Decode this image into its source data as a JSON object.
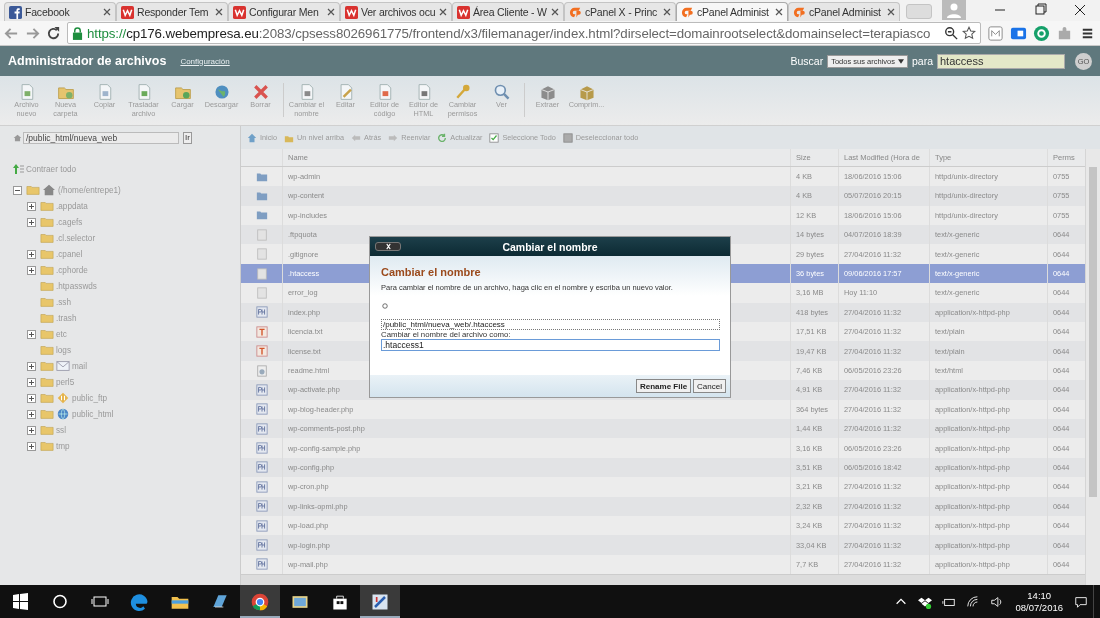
{
  "browser": {
    "tabs": [
      {
        "title": "Facebook",
        "kind": "facebook",
        "selected": false
      },
      {
        "title": "Responder Tem",
        "kind": "w",
        "selected": false
      },
      {
        "title": "Configurar Men",
        "kind": "w",
        "selected": false
      },
      {
        "title": "Ver archivos ocu",
        "kind": "w",
        "selected": false
      },
      {
        "title": "Área Cliente - W",
        "kind": "w",
        "selected": false
      },
      {
        "title": "cPanel X - Princ",
        "kind": "cpanel",
        "selected": false
      },
      {
        "title": "cPanel Administ",
        "kind": "cpanel",
        "selected": true
      },
      {
        "title": "cPanel Administ",
        "kind": "cpanel",
        "selected": false
      }
    ],
    "url": {
      "scheme": "https://",
      "host": "cp176.webempresa.eu",
      "rest": ":2083/cpsess8026961775/frontend/x3/filemanager/index.html?dirselect=domainrootselect&domainselect=terapiasco"
    }
  },
  "header": {
    "title": "Administrador de archivos",
    "settings_link": "Configuración",
    "search_label": "Buscar",
    "scope": "Todos sus archivos",
    "for_label": "para",
    "query": "htaccess",
    "go": "GO"
  },
  "toolbar": {
    "groups": [
      {
        "items": [
          {
            "label": "Archivo nuevo",
            "kind": "new-file"
          },
          {
            "label": "Nueva carpeta",
            "kind": "new-folder"
          },
          {
            "label": "Copiar",
            "kind": "copy"
          },
          {
            "label": "Trasladar archivo",
            "kind": "move"
          },
          {
            "label": "Cargar",
            "kind": "upload"
          },
          {
            "label": "Descargar",
            "kind": "download"
          },
          {
            "label": "Borrar",
            "kind": "delete"
          }
        ]
      },
      {
        "items": [
          {
            "label": "Cambiar el nombre",
            "kind": "rename"
          },
          {
            "label": "Editar",
            "kind": "edit"
          },
          {
            "label": "Editor de código",
            "kind": "code"
          },
          {
            "label": "Editor de HTML",
            "kind": "html"
          },
          {
            "label": "Cambiar permisos",
            "kind": "permissions"
          },
          {
            "label": "Ver",
            "kind": "view"
          }
        ]
      },
      {
        "items": [
          {
            "label": "Extraer",
            "kind": "extract"
          },
          {
            "label": "Comprim...",
            "kind": "compress"
          }
        ]
      }
    ]
  },
  "path": {
    "value": "/public_html/nueva_web",
    "go": "Ir"
  },
  "nav": [
    {
      "label": "Inicio",
      "kind": "home"
    },
    {
      "label": "Un nivel arriba",
      "kind": "up"
    },
    {
      "label": "Atrás",
      "kind": "back"
    },
    {
      "label": "Reenviar",
      "kind": "forward"
    },
    {
      "label": "Actualizar",
      "kind": "refresh"
    },
    {
      "label": "Seleccione Todo",
      "kind": "check"
    },
    {
      "label": "Deseleccionar todo",
      "kind": "uncheck"
    }
  ],
  "tree": {
    "collapse_all": "Contraer todo",
    "root": {
      "name": "(/home/entrepe1)",
      "expanded": true,
      "children": [
        {
          "name": ".appdata",
          "kind": "folder",
          "collapsed": true
        },
        {
          "name": ".cagefs",
          "kind": "folder",
          "collapsed": true
        },
        {
          "name": ".cl.selector",
          "kind": "folder",
          "collapsed": false
        },
        {
          "name": ".cpanel",
          "kind": "folder",
          "collapsed": true
        },
        {
          "name": ".cphorde",
          "kind": "folder",
          "collapsed": true
        },
        {
          "name": ".htpasswds",
          "kind": "folder",
          "collapsed": false
        },
        {
          "name": ".ssh",
          "kind": "folder",
          "collapsed": false
        },
        {
          "name": ".trash",
          "kind": "folder",
          "collapsed": false
        },
        {
          "name": "etc",
          "kind": "folder",
          "collapsed": true
        },
        {
          "name": "logs",
          "kind": "folder",
          "collapsed": false
        },
        {
          "name": "mail",
          "kind": "mail",
          "collapsed": true
        },
        {
          "name": "perl5",
          "kind": "folder",
          "collapsed": true
        },
        {
          "name": "public_ftp",
          "kind": "ftp",
          "collapsed": true
        },
        {
          "name": "public_html",
          "kind": "web",
          "collapsed": true
        },
        {
          "name": "ssl",
          "kind": "folder",
          "collapsed": true
        },
        {
          "name": "tmp",
          "kind": "folder",
          "collapsed": true
        }
      ]
    }
  },
  "table": {
    "columns": [
      "Name",
      "Size",
      "Last Modified (Hora de",
      "Type",
      "Perms"
    ],
    "rows": [
      {
        "kind": "folder",
        "name": "wp-admin",
        "size": "4 KB",
        "modified": "18/06/2016 15:06",
        "type": "httpd/unix-directory",
        "perms": "0755",
        "selected": false
      },
      {
        "kind": "folder",
        "name": "wp-content",
        "size": "4 KB",
        "modified": "05/07/2016 20:15",
        "type": "httpd/unix-directory",
        "perms": "0755",
        "selected": false
      },
      {
        "kind": "folder",
        "name": "wp-includes",
        "size": "12 KB",
        "modified": "18/06/2016 15:06",
        "type": "httpd/unix-directory",
        "perms": "0755",
        "selected": false
      },
      {
        "kind": "text",
        "name": ".ftpquota",
        "size": "14 bytes",
        "modified": "04/07/2016 18:39",
        "type": "text/x-generic",
        "perms": "0644",
        "selected": false
      },
      {
        "kind": "text",
        "name": ".gitignore",
        "size": "29 bytes",
        "modified": "27/04/2016 11:32",
        "type": "text/x-generic",
        "perms": "0644",
        "selected": false
      },
      {
        "kind": "text",
        "name": ".htaccess",
        "size": "36 bytes",
        "modified": "09/06/2016 17:57",
        "type": "text/x-generic",
        "perms": "0644",
        "selected": true
      },
      {
        "kind": "text",
        "name": "error_log",
        "size": "3,16 MB",
        "modified": "Hoy 11:10",
        "type": "text/x-generic",
        "perms": "0644",
        "selected": false
      },
      {
        "kind": "php",
        "name": "index.php",
        "size": "418 bytes",
        "modified": "27/04/2016 11:32",
        "type": "application/x-httpd-php",
        "perms": "0644",
        "selected": false
      },
      {
        "kind": "txt",
        "name": "licencia.txt",
        "size": "17,51 KB",
        "modified": "27/04/2016 11:32",
        "type": "text/plain",
        "perms": "0644",
        "selected": false
      },
      {
        "kind": "txt",
        "name": "license.txt",
        "size": "19,47 KB",
        "modified": "27/04/2016 11:32",
        "type": "text/plain",
        "perms": "0644",
        "selected": false
      },
      {
        "kind": "html",
        "name": "readme.html",
        "size": "7,46 KB",
        "modified": "06/05/2016 23:26",
        "type": "text/html",
        "perms": "0644",
        "selected": false
      },
      {
        "kind": "php",
        "name": "wp-activate.php",
        "size": "4,91 KB",
        "modified": "27/04/2016 11:32",
        "type": "application/x-httpd-php",
        "perms": "0644",
        "selected": false
      },
      {
        "kind": "php",
        "name": "wp-blog-header.php",
        "size": "364 bytes",
        "modified": "27/04/2016 11:32",
        "type": "application/x-httpd-php",
        "perms": "0644",
        "selected": false
      },
      {
        "kind": "php",
        "name": "wp-comments-post.php",
        "size": "1,44 KB",
        "modified": "27/04/2016 11:32",
        "type": "application/x-httpd-php",
        "perms": "0644",
        "selected": false
      },
      {
        "kind": "php",
        "name": "wp-config-sample.php",
        "size": "3,16 KB",
        "modified": "06/05/2016 23:26",
        "type": "application/x-httpd-php",
        "perms": "0644",
        "selected": false
      },
      {
        "kind": "php",
        "name": "wp-config.php",
        "size": "3,51 KB",
        "modified": "06/05/2016 18:42",
        "type": "application/x-httpd-php",
        "perms": "0644",
        "selected": false
      },
      {
        "kind": "php",
        "name": "wp-cron.php",
        "size": "3,21 KB",
        "modified": "27/04/2016 11:32",
        "type": "application/x-httpd-php",
        "perms": "0644",
        "selected": false
      },
      {
        "kind": "php",
        "name": "wp-links-opml.php",
        "size": "2,32 KB",
        "modified": "27/04/2016 11:32",
        "type": "application/x-httpd-php",
        "perms": "0644",
        "selected": false
      },
      {
        "kind": "php",
        "name": "wp-load.php",
        "size": "3,24 KB",
        "modified": "27/04/2016 11:32",
        "type": "application/x-httpd-php",
        "perms": "0644",
        "selected": false
      },
      {
        "kind": "php",
        "name": "wp-login.php",
        "size": "33,04 KB",
        "modified": "27/04/2016 11:32",
        "type": "application/x-httpd-php",
        "perms": "0644",
        "selected": false
      },
      {
        "kind": "php",
        "name": "wp-mail.php",
        "size": "7,7 KB",
        "modified": "27/04/2016 11:32",
        "type": "application/x-httpd-php",
        "perms": "0644",
        "selected": false
      }
    ]
  },
  "dialog": {
    "title": "Cambiar el nombre",
    "heading": "Cambiar el nombre",
    "text": "Para cambiar el nombre de un archivo, haga clic en el nombre y escriba un nuevo valor.",
    "current_path": "/public_html/nueva_web/.htaccess",
    "new_name_label": "Cambiar el nombre del archivo como:",
    "new_name": ".htaccess1",
    "buttons": [
      "Rename File",
      "Cancel"
    ]
  },
  "taskbar": {
    "apps": [
      {
        "kind": "edge",
        "selected": false
      },
      {
        "kind": "folder",
        "selected": false
      },
      {
        "kind": "notes",
        "selected": false
      },
      {
        "kind": "chrome",
        "selected": true
      },
      {
        "kind": "photos",
        "selected": false
      },
      {
        "kind": "store",
        "selected": false
      },
      {
        "kind": "tool",
        "selected": true
      }
    ],
    "time": "14:10",
    "date": "08/07/2016"
  }
}
